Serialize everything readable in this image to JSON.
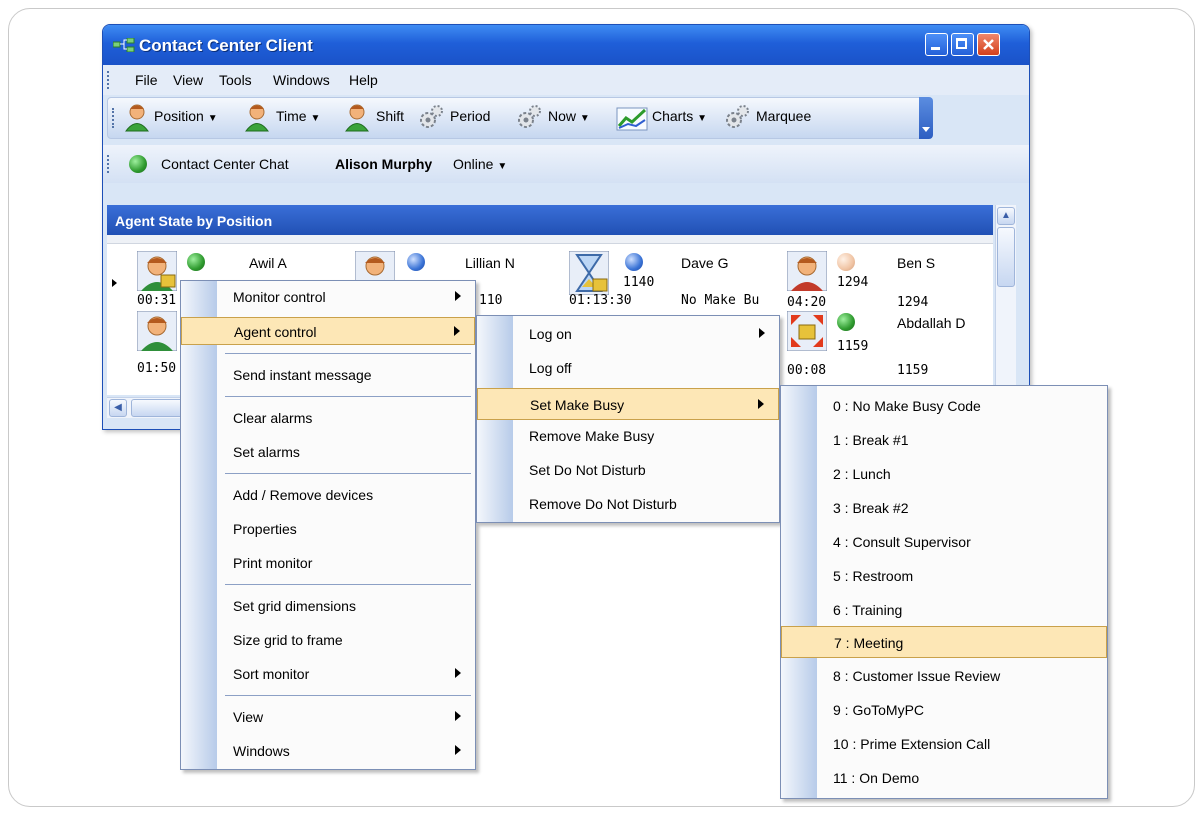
{
  "window": {
    "title": "Contact Center Client"
  },
  "menubar": [
    "File",
    "View",
    "Tools",
    "Windows",
    "Help"
  ],
  "toolbar": {
    "position": "Position",
    "time": "Time",
    "shift": "Shift",
    "period": "Period",
    "now": "Now",
    "charts": "Charts",
    "marquee": "Marquee"
  },
  "chatbar": {
    "label": "Contact Center Chat",
    "user": "Alison Murphy",
    "status": "Online"
  },
  "panel": {
    "title": "Agent State by Position"
  },
  "agents": [
    {
      "name": "Awil A",
      "time": "00:31",
      "ext": ""
    },
    {
      "name": "Lillian N",
      "time": "",
      "ext": "110"
    },
    {
      "name": "Dave G",
      "time": "01:13:30",
      "ext": "1140",
      "state": "No Make Bu"
    },
    {
      "name": "Ben S",
      "time": "04:20",
      "ext": "1294",
      "ext2": "1294"
    },
    {
      "name": "",
      "time": "01:50",
      "ext": ""
    },
    {
      "name": "Abdallah D",
      "time": "00:08",
      "ext": "1159",
      "ext2": "1159"
    }
  ],
  "menu1": {
    "items": [
      "Monitor control",
      "Agent control",
      "Send instant message",
      "Clear alarms",
      "Set alarms",
      "Add / Remove devices",
      "Properties",
      "Print monitor",
      "Set grid dimensions",
      "Size grid to frame",
      "Sort monitor",
      "View",
      "Windows"
    ]
  },
  "menu2": {
    "items": [
      "Log on",
      "Log off",
      "Set Make Busy",
      "Remove Make Busy",
      "Set Do Not Disturb",
      "Remove Do Not Disturb"
    ]
  },
  "menu3": {
    "items": [
      "0 : No Make Busy Code",
      "1 : Break #1",
      "2 : Lunch",
      "3 : Break #2",
      "4 : Consult Supervisor",
      "5 : Restroom",
      "6 : Training",
      "7 : Meeting",
      "8 : Customer Issue Review",
      "9 : GoToMyPC",
      "10 : Prime Extension Call",
      "11 : On Demo"
    ]
  },
  "colors": {
    "titlebar": "#1f5fd9",
    "highlight": "#fde7b6",
    "online": "#2e9a2e"
  }
}
